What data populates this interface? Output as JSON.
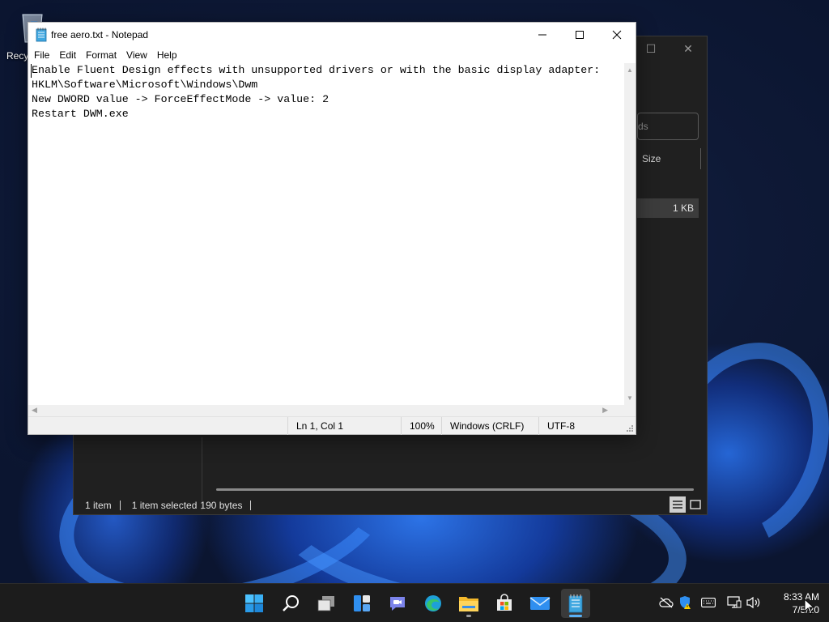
{
  "desktop": {
    "recycle_bin_label": "Recy"
  },
  "explorer": {
    "search_placeholder": "ds",
    "column_size": "Size",
    "file_size": "1 KB",
    "status_items": "1 item",
    "status_selected": "1 item selected",
    "status_bytes": "190 bytes"
  },
  "notepad": {
    "title": "free aero.txt - Notepad",
    "menu": {
      "file": "File",
      "edit": "Edit",
      "format": "Format",
      "view": "View",
      "help": "Help"
    },
    "lines": [
      "Enable Fluent Design effects with unsupported drivers or with the basic display adapter:",
      "HKLM\\Software\\Microsoft\\Windows\\Dwm",
      "New DWORD value -> ForceEffectMode -> value: 2",
      "Restart DWM.exe"
    ],
    "status": {
      "position": "Ln 1, Col 1",
      "zoom": "100%",
      "line_endings": "Windows (CRLF)",
      "encoding": "UTF-8"
    }
  },
  "taskbar": {
    "apps": [
      "start-icon",
      "search-icon",
      "task-view-icon",
      "widgets-icon",
      "chat-icon",
      "edge-icon",
      "file-explorer-icon",
      "store-icon",
      "mail-icon",
      "notepad-icon"
    ],
    "clock_time": "8:33 AM",
    "clock_date": "7/5/20"
  },
  "colors": {
    "accent": "#0078d4",
    "taskbar": "#1c1c1c",
    "explorer_bg": "#202020"
  }
}
